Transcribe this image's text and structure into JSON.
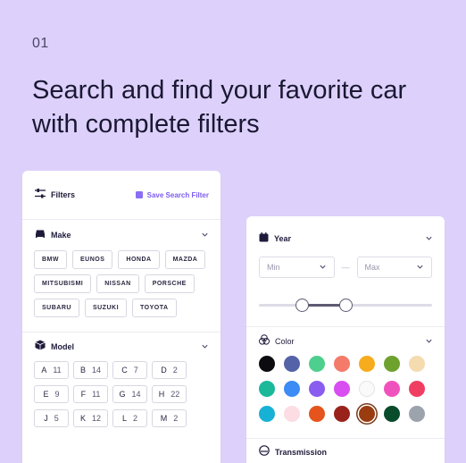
{
  "step_number": "01",
  "headline": "Search and find your favorite car with complete filters",
  "filters_panel": {
    "title": "Filters",
    "save_label": "Save Search Filter",
    "make": {
      "title": "Make",
      "options": [
        "BMW",
        "EUNOS",
        "HONDA",
        "MAZDA",
        "MITSUBISMI",
        "NISSAN",
        "PORSCHE",
        "SUBARU",
        "SUZUKI",
        "TOYOTA"
      ]
    },
    "model": {
      "title": "Model",
      "options": [
        {
          "letter": "A",
          "count": "11"
        },
        {
          "letter": "B",
          "count": "14"
        },
        {
          "letter": "C",
          "count": "7"
        },
        {
          "letter": "D",
          "count": "2"
        },
        {
          "letter": "E",
          "count": "9"
        },
        {
          "letter": "F",
          "count": "11"
        },
        {
          "letter": "G",
          "count": "14"
        },
        {
          "letter": "H",
          "count": "22"
        },
        {
          "letter": "J",
          "count": "5"
        },
        {
          "letter": "K",
          "count": "12"
        },
        {
          "letter": "L",
          "count": "2"
        },
        {
          "letter": "M",
          "count": "2"
        }
      ]
    }
  },
  "details_panel": {
    "year": {
      "title": "Year",
      "min_placeholder": "Min",
      "max_placeholder": "Max",
      "separator": "—",
      "range_fraction": [
        0.25,
        0.5
      ]
    },
    "color": {
      "title": "Color",
      "swatches": [
        "#0c0c10",
        "#5462a8",
        "#4ecf8e",
        "#f47a6a",
        "#f7ac1e",
        "#6ea12e",
        "#f5dbb0",
        "#1bb89a",
        "#3b8cf5",
        "#8a5cf0",
        "#d84ef0",
        "#fafafb",
        "#f052bd",
        "#f03e62",
        "#17b1d6",
        "#fbdde3",
        "#e5541c",
        "#9a221c",
        "#9a3c10",
        "#084c2c",
        "#9da3ad"
      ],
      "selected_index": 18
    },
    "transmission": {
      "title": "Transmission"
    }
  },
  "colors": {
    "background": "#ddd1fb",
    "accent": "#7c5cf0"
  }
}
